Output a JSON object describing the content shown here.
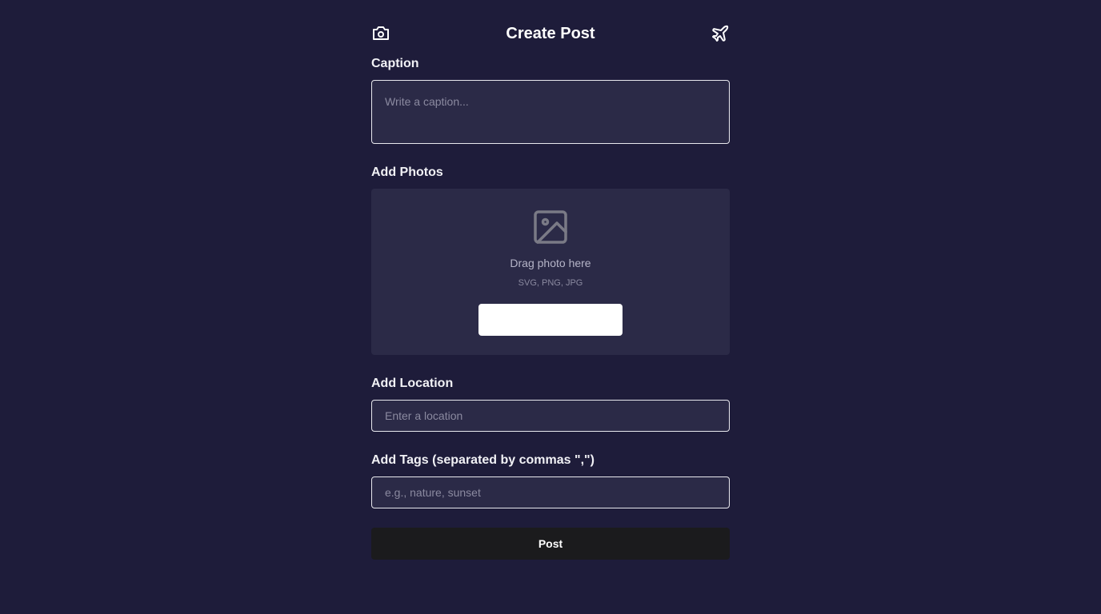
{
  "header": {
    "title": "Create Post",
    "left_icon": "camera-icon",
    "right_icon": "airplane-icon"
  },
  "caption": {
    "label": "Caption",
    "placeholder": "Write a caption...",
    "value": ""
  },
  "photos": {
    "label": "Add Photos",
    "icon": "image-icon",
    "drag_text": "Drag photo here",
    "formats": "SVG, PNG, JPG",
    "button_label": ""
  },
  "location": {
    "label": "Add Location",
    "placeholder": "Enter a location",
    "value": ""
  },
  "tags": {
    "label": "Add Tags (separated by commas \",\")",
    "placeholder": "e.g., nature, sunset",
    "value": ""
  },
  "submit": {
    "label": "Post"
  },
  "colors": {
    "background": "#1e1c3a",
    "field_background": "#2b2a47",
    "field_border": "#e8e8ee",
    "post_button": "#1b1b1d",
    "select_button": "#ffffff"
  }
}
